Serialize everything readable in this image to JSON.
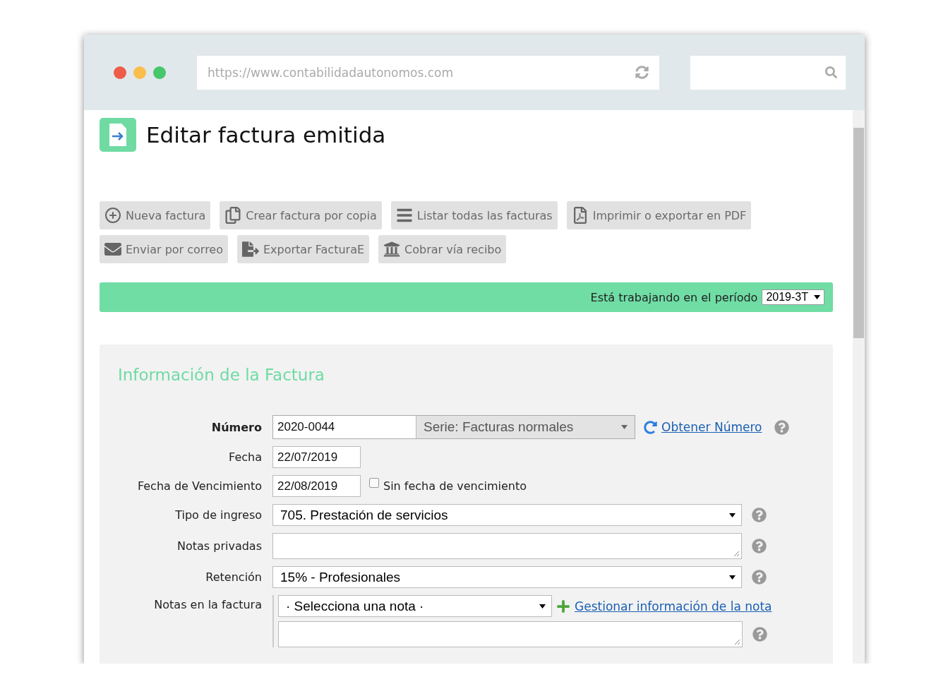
{
  "browser": {
    "url": "https://www.contabilidadautonomos.com"
  },
  "page": {
    "title": "Editar factura emitida"
  },
  "toolbar_rows": [
    {
      "buttons": [
        {
          "label": "Nueva factura"
        },
        {
          "label": "Crear factura por copia"
        },
        {
          "label": "Listar todas las facturas"
        },
        {
          "label": "Imprimir o exportar en PDF"
        }
      ]
    },
    {
      "buttons": [
        {
          "label": "Enviar por correo"
        },
        {
          "label": "Exportar FacturaE"
        },
        {
          "label": "Cobrar vía recibo"
        }
      ]
    }
  ],
  "period_bar": {
    "label": "Está trabajando en el período",
    "value": "2019-3T"
  },
  "form": {
    "heading": "Información de la Factura",
    "rows": [
      {
        "kind": "number",
        "label": "Número",
        "value": "2020-0044",
        "series": "Serie: Facturas normales",
        "link": "Obtener Número",
        "help": true
      },
      {
        "kind": "date",
        "label": "Fecha",
        "value": "22/07/2019"
      },
      {
        "kind": "date",
        "label": "Fecha de Vencimiento",
        "value": "22/08/2019",
        "checkbox": {
          "label": "Sin fecha de vencimiento",
          "checked": false
        }
      },
      {
        "kind": "select",
        "label": "Tipo de ingreso",
        "value": "705. Prestación de servicios",
        "help": true
      },
      {
        "kind": "textarea",
        "label": "Notas privadas",
        "help": true
      },
      {
        "kind": "select",
        "label": "Retención",
        "value": "15% - Profesionales",
        "help": true
      },
      {
        "kind": "notes",
        "label": "Notas en la factura",
        "value": "· Selecciona una nota ·",
        "link": "Gestionar información de la nota",
        "help": true
      }
    ]
  }
}
